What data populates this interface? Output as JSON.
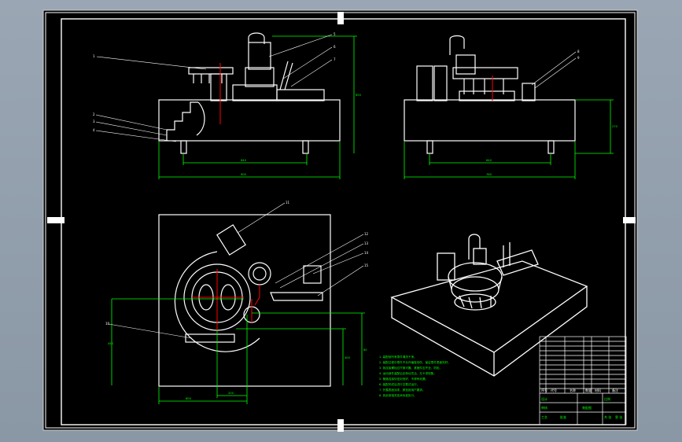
{
  "drawing": {
    "notes": [
      "1. 装配前所有零件清洗干净。",
      "2. 装配过程中零件不允许磕碰划伤，保证零件表面完好。",
      "3. 各连接螺栓应拧紧可靠，紧固件应齐全、防松。",
      "4. 运动部件装配后应转动灵活，无卡滞现象。",
      "5. 管路连接处密封良好，不得有泄漏。",
      "6. 装配完成后进行空载试运行。",
      "7. 外露表面涂漆，颜色按用户要求。",
      "8. 其余按相关技术标准执行。"
    ],
    "dims": {
      "front_overall": "900",
      "front_inner": "640",
      "front_height": "650",
      "side_overall": "760",
      "side_inner": "640",
      "side_height": "270",
      "plan_width": "600",
      "plan_bottom": "200",
      "plan_left": "450",
      "plan_right": "400",
      "plan_small": "80"
    },
    "callouts": [
      "1",
      "2",
      "3",
      "4",
      "5",
      "6",
      "7",
      "8",
      "9",
      "10",
      "11",
      "12",
      "13",
      "14",
      "15",
      "16"
    ],
    "title_block": {
      "cells": [
        "序号",
        "代号",
        "名称",
        "数量",
        "材料",
        "备注",
        "设计",
        "审核",
        "工艺",
        "批准",
        "比例",
        "共 张",
        "第 张"
      ],
      "drawing_title": "装配图"
    },
    "colors": {
      "background": "#000000",
      "frame": "#ffffff",
      "geometry": "#ffffff",
      "dimension": "#00ff00",
      "center": "#ff0000",
      "outer": "#8d98a5"
    }
  }
}
